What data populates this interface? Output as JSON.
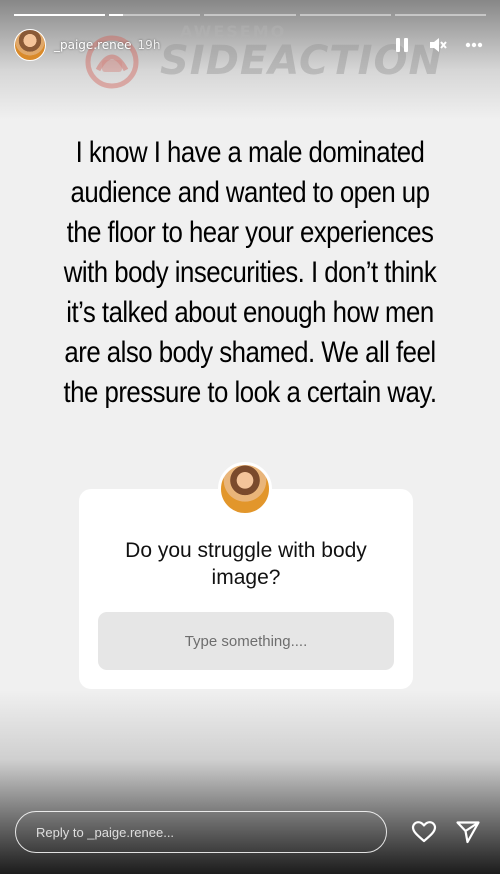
{
  "story": {
    "progress": [
      1,
      0.15,
      0,
      0,
      0
    ],
    "username": "_paige.renee",
    "timestamp": "19h",
    "text": "I know I have a male dominated audience and wanted to open up the floor to hear your experiences with body insecurities. I don’t think it’s talked about enough how men are also body shamed. We all feel the pressure to look a certain way.",
    "watermark": {
      "small": "AWESEMO",
      "big": "SIDEACTION"
    }
  },
  "question": {
    "prompt": "Do you struggle with body image?",
    "placeholder": "Type something...."
  },
  "reply": {
    "placeholder": "Reply to _paige.renee..."
  },
  "icons": {
    "pause": "pause-icon",
    "mute": "mute-icon",
    "more": "more-icon",
    "like": "heart-icon",
    "send": "send-icon"
  },
  "colors": {
    "card": "#ffffff",
    "answer_box": "#e6e6e6",
    "text": "#000000"
  }
}
